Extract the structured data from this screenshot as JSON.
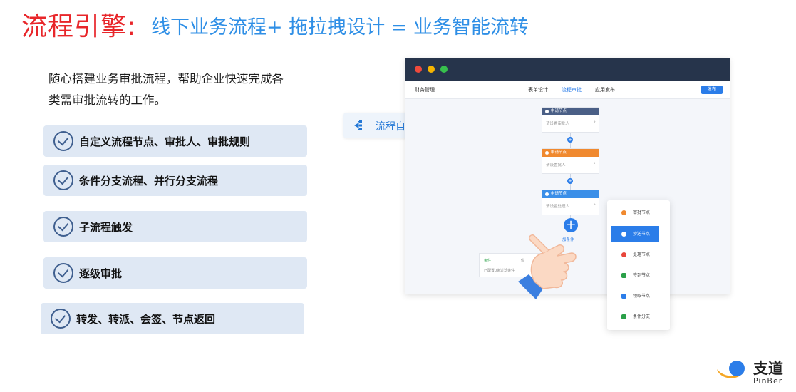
{
  "title": {
    "main": "流程引擎:",
    "sub": "线下业务流程+ 拖拉拽设计 = 业务智能流转"
  },
  "intro": {
    "line1": "随心搭建业务审批流程，帮助企业快速完成各",
    "line2": "类需审批流转的工作。"
  },
  "features": [
    "自定义流程节点、审批人、审批规则",
    "条件分支流程、并行分支流程",
    "子流程触发",
    "逐级审批",
    "转发、转派、会签、节点返回"
  ],
  "automation_tag": {
    "label": "流程自动化",
    "icon": "flow-branch-icon"
  },
  "app_window": {
    "title_dots": [
      "#ef4a3c",
      "#f5b400",
      "#37c04d"
    ],
    "toolbar": {
      "left_label": "财务管理",
      "tabs": [
        "表单设计",
        "流程审批",
        "应用发布"
      ],
      "active_tab": "流程审批",
      "publish_button": "发布"
    },
    "nodes": [
      {
        "header": "申请节点",
        "placeholder": "请设置审批人",
        "color": "#4a5f86"
      },
      {
        "header": "申请节点",
        "placeholder": "请设置批人",
        "color": "#f0892f"
      },
      {
        "header": "申请节点",
        "placeholder": "请设置处理人",
        "color": "#3b8fe8"
      }
    ],
    "add_condition_label": "加条件",
    "condition_card": {
      "title": "条件",
      "body": "已配置0条过滤条件"
    },
    "condition_card_2": {
      "title": "优"
    }
  },
  "node_menu": {
    "items": [
      {
        "label": "审批节点",
        "icon": "user-icon",
        "color": "#f0892f"
      },
      {
        "label": "抄送节点",
        "icon": "send-icon",
        "color": "#ffffff"
      },
      {
        "label": "处理节点",
        "icon": "user-settings-icon",
        "color": "#e8463b"
      },
      {
        "label": "签到节点",
        "icon": "checkin-icon",
        "color": "#2aa048"
      },
      {
        "label": "领取节点",
        "icon": "receive-icon",
        "color": "#2b7de9"
      },
      {
        "label": "条件分支",
        "icon": "branch-icon",
        "color": "#2aa048"
      }
    ],
    "active_item": "抄送节点"
  },
  "logo": {
    "name": "支道",
    "en": "PinBer"
  },
  "colors": {
    "title_red": "#e8262a",
    "title_blue": "#2f8fe6",
    "feature_bg": "#dfe8f4",
    "window_header": "#26344b",
    "accent": "#2b7de9"
  }
}
